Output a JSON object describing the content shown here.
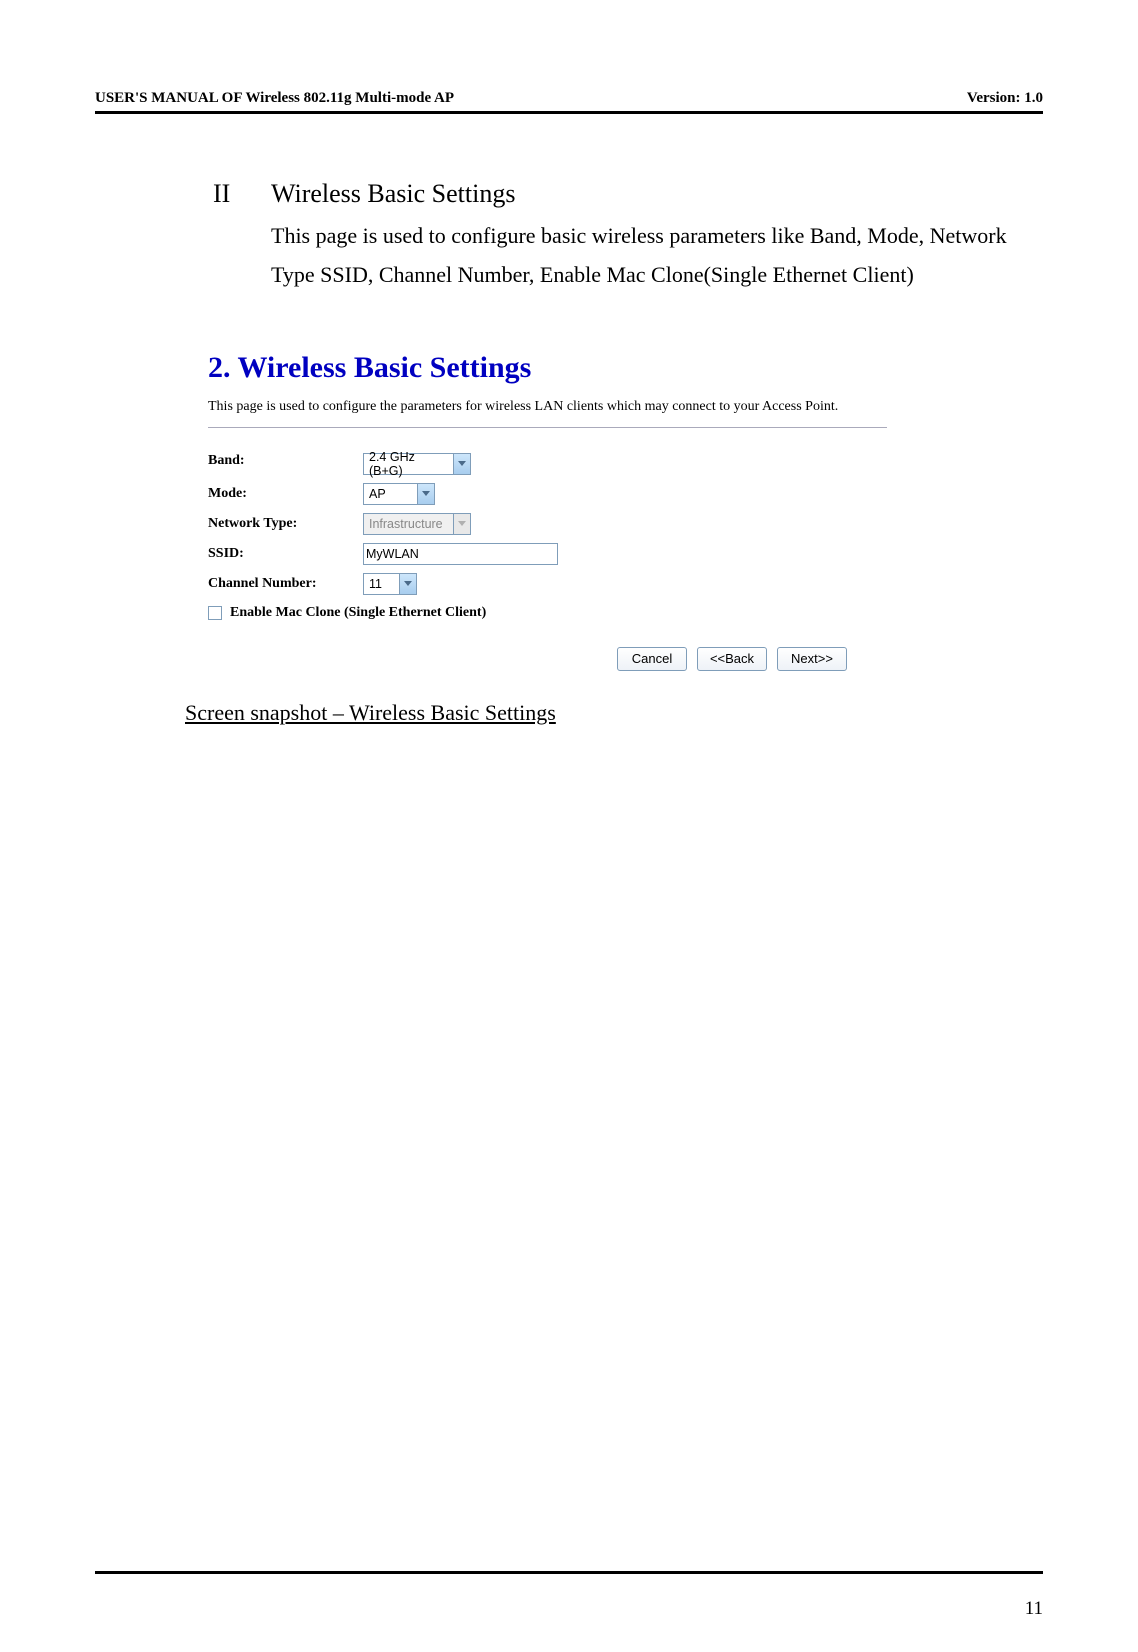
{
  "header": {
    "left": "USER'S MANUAL OF Wireless 802.11g Multi-mode AP",
    "right": "Version: 1.0"
  },
  "section": {
    "roman": "II",
    "title": "Wireless Basic Settings",
    "body": "This page is used to configure basic wireless parameters like Band, Mode, Network Type SSID, Channel Number, Enable Mac Clone(Single Ethernet Client)"
  },
  "screenshot": {
    "title": "2. Wireless Basic Settings",
    "desc": "This page is used to configure the parameters for wireless LAN clients which may connect to your Access Point.",
    "labels": {
      "band": "Band:",
      "mode": "Mode:",
      "network_type": "Network Type:",
      "ssid": "SSID:",
      "channel": "Channel Number:"
    },
    "values": {
      "band": "2.4 GHz (B+G)",
      "mode": "AP",
      "network_type": "Infrastructure",
      "ssid": "MyWLAN",
      "channel": "11"
    },
    "checkbox_label": "Enable Mac Clone (Single Ethernet Client)",
    "buttons": {
      "cancel": "Cancel",
      "back": "<<Back",
      "next": "Next>>"
    }
  },
  "caption": "Screen snapshot – Wireless Basic Settings",
  "page_number": "11"
}
